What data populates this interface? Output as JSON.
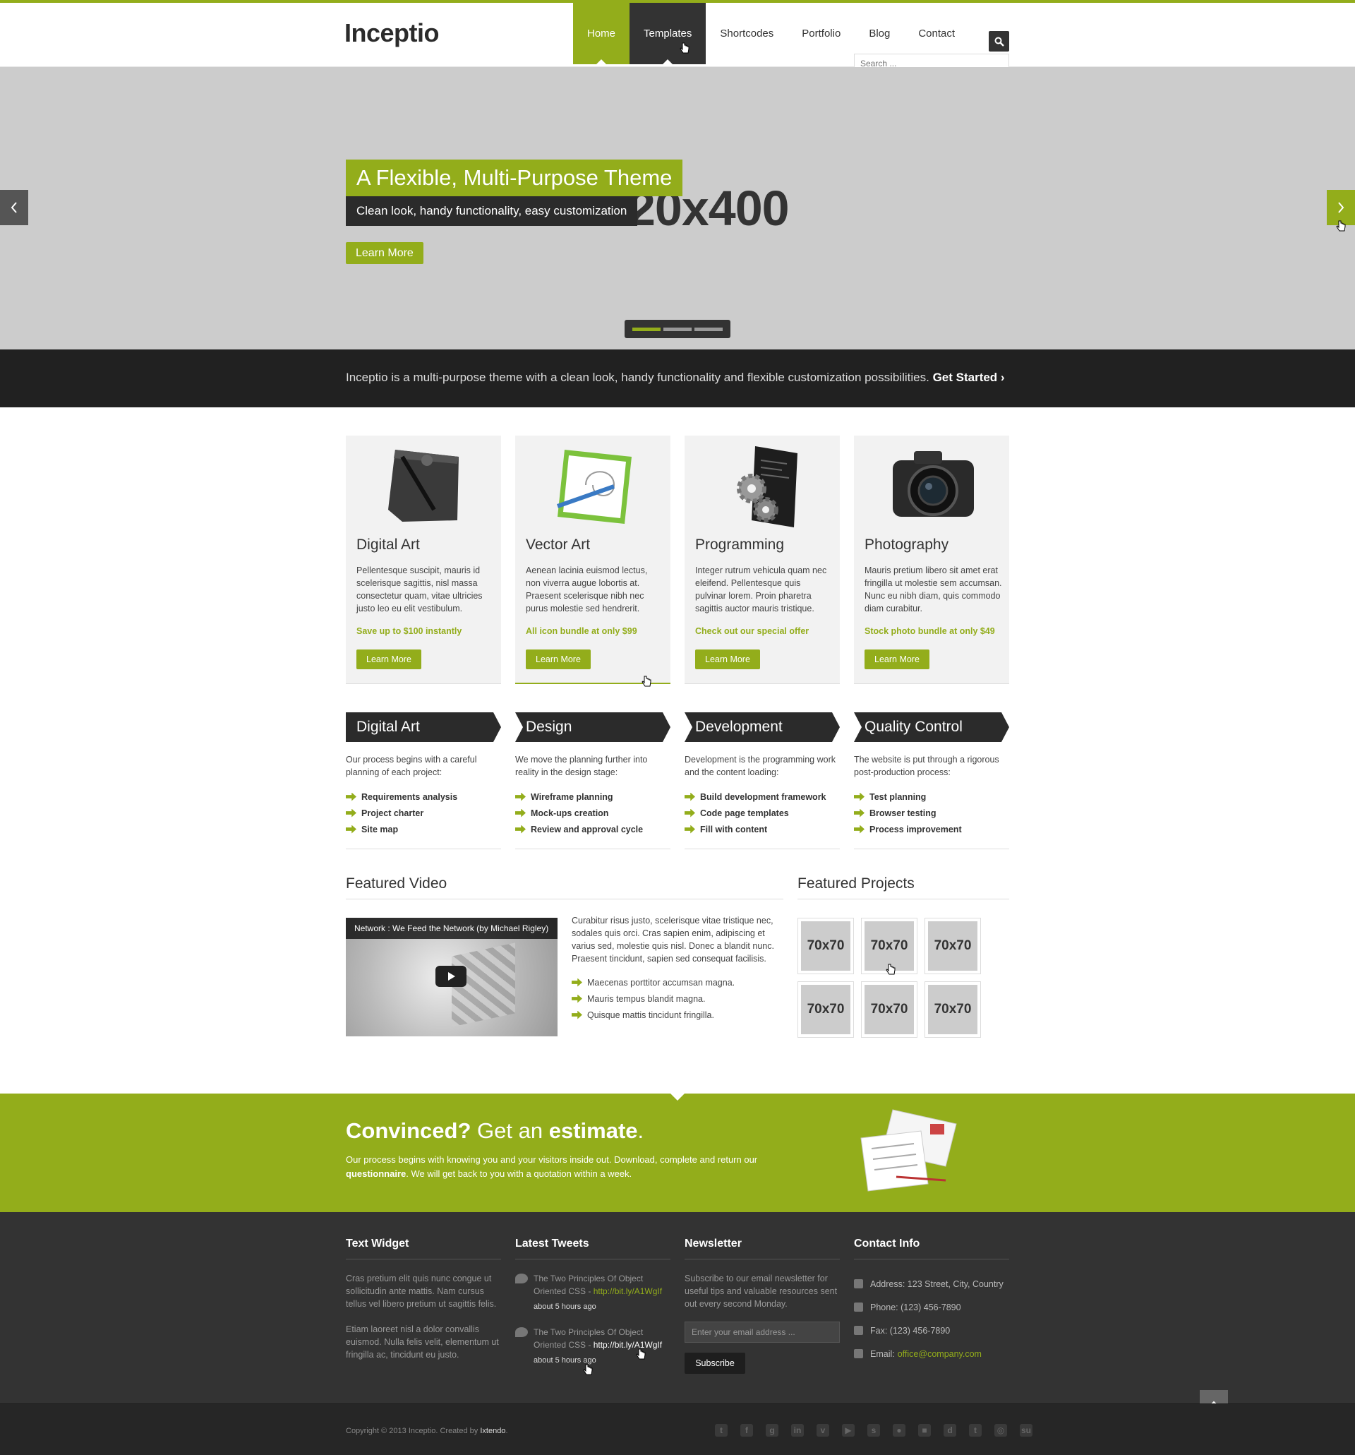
{
  "brand": {
    "logo": "Inceptio",
    "accent": "#93ad1b",
    "dark": "#2b2b2b"
  },
  "nav": {
    "items": [
      "Home",
      "Templates",
      "Shortcodes",
      "Portfolio",
      "Blog",
      "Contact"
    ],
    "active": "Home",
    "hover": "Templates",
    "search_placeholder": "Search ...",
    "search_icon": "search-icon"
  },
  "slider": {
    "placeholder": "20x400",
    "title": "A Flexible, Multi-Purpose Theme",
    "subtitle": "Clean look, handy functionality, easy customization",
    "button": "Learn More",
    "slides": 3,
    "current": 1
  },
  "band": {
    "text": "Inceptio is a multi-purpose theme with a clean look, handy functionality and flexible customization possibilities.",
    "link": "Get Started ›"
  },
  "services": [
    {
      "icon": "drawing-tablet-icon",
      "title": "Digital Art",
      "text": "Pellentesque suscipit, mauris id scelerisque sagittis, nisl massa consectetur quam, vitae ultricies justo leo eu elit vestibulum.",
      "offer": "Save up to $100 instantly",
      "button": "Learn More"
    },
    {
      "icon": "vector-pen-icon",
      "title": "Vector Art",
      "text": "Aenean lacinia euismod lectus, non viverra augue lobortis at. Praesent scelerisque nibh nec purus molestie sed hendrerit.",
      "offer": "All icon bundle at only $99",
      "button": "Learn More"
    },
    {
      "icon": "gears-code-icon",
      "title": "Programming",
      "text": "Integer rutrum vehicula quam nec eleifend. Pellentesque quis pulvinar lorem. Proin pharetra sagittis auctor mauris tristique.",
      "offer": "Check out our special offer",
      "button": "Learn More"
    },
    {
      "icon": "camera-icon",
      "title": "Photography",
      "text": "Mauris pretium libero sit amet erat fringilla ut molestie sem accumsan. Nunc eu nibh diam, quis commodo diam curabitur.",
      "offer": "Stock photo bundle at only $49",
      "button": "Learn More"
    }
  ],
  "process": [
    {
      "title": "Digital Art",
      "text": "Our process begins with a careful planning of each project:",
      "items": [
        "Requirements analysis",
        "Project charter",
        "Site map"
      ]
    },
    {
      "title": "Design",
      "text": "We move the planning further into reality in the design stage:",
      "items": [
        "Wireframe planning",
        "Mock-ups creation",
        "Review and approval cycle"
      ]
    },
    {
      "title": "Development",
      "text": "Development is the programming work and the content loading:",
      "items": [
        "Build development framework",
        "Code page templates",
        "Fill with content"
      ]
    },
    {
      "title": "Quality Control",
      "text": "The website is put through a rigorous post-production process:",
      "items": [
        "Test planning",
        "Browser testing",
        "Process improvement"
      ]
    }
  ],
  "featured_video": {
    "title": "Featured Video",
    "video_title": "Network : We Feed the Network (by Michael Rigley)",
    "text": "Curabitur risus justo, scelerisque vitae tristique nec, sodales quis orci. Cras sapien enim, adipiscing et varius sed, molestie quis nisl. Donec a blandit nunc. Praesent tincidunt, sapien sed consequat facilisis.",
    "items": [
      "Maecenas porttitor accumsan magna.",
      "Mauris tempus blandit magna.",
      "Quisque mattis tincidunt fringilla."
    ]
  },
  "featured_projects": {
    "title": "Featured Projects",
    "thumbs": [
      "70x70",
      "70x70",
      "70x70",
      "70x70",
      "70x70",
      "70x70"
    ]
  },
  "cta": {
    "title_1": "Convinced?",
    "title_2": "Get an",
    "title_3": "estimate",
    "title_4": ".",
    "text_1": "Our process begins with knowing you and your visitors inside out. Download, complete and return our",
    "text_bold": "questionnaire",
    "text_2": ". We will get back to you with a quotation within a week."
  },
  "footer": {
    "text_widget": {
      "title": "Text Widget",
      "p1": "Cras pretium elit quis nunc congue ut sollicitudin ante mattis. Nam cursus tellus vel libero pretium ut sagittis felis.",
      "p2": "Etiam laoreet nisl a dolor convallis euismod. Nulla felis velit, elementum ut fringilla ac, tincidunt eu justo."
    },
    "tweets": {
      "title": "Latest Tweets",
      "items": [
        {
          "text": "The Two Principles Of Object Oriented CSS - ",
          "link": "http://bit.ly/A1WgIf",
          "time": "about 5 hours ago"
        },
        {
          "text": "The Two Principles Of Object Oriented CSS - ",
          "link": "http://bit.ly/A1WgIf",
          "time": "about 5 hours ago"
        }
      ]
    },
    "newsletter": {
      "title": "Newsletter",
      "text": "Subscribe to our email newsletter for useful tips and valuable resources sent out every second Monday.",
      "placeholder": "Enter your email address ...",
      "button": "Subscribe"
    },
    "contact": {
      "title": "Contact Info",
      "address": "Address: 123 Street, City, Country",
      "phone": "Phone: (123) 456-7890",
      "fax": "Fax: (123) 456-7890",
      "email_label": "Email:",
      "email": "office@company.com"
    }
  },
  "copyright": {
    "text": "Copyright © 2013 Inceptio. Created by",
    "author": "Ixtendo",
    "suffix": ".",
    "socials": [
      "twitter-icon",
      "facebook-icon",
      "google-plus-icon",
      "linkedin-icon",
      "vimeo-icon",
      "youtube-icon",
      "skype-icon",
      "flickr-icon",
      "delicious-icon",
      "digg-icon",
      "tumblr-icon",
      "dribbble-icon",
      "stumbleupon-icon"
    ]
  }
}
